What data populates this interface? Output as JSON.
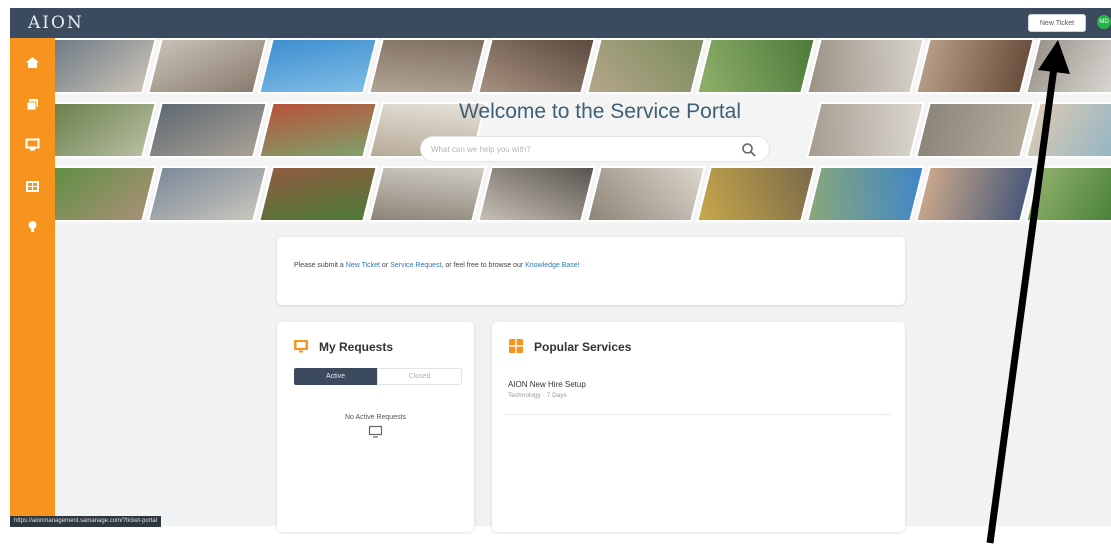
{
  "header": {
    "logo_text": "AION",
    "new_ticket_label": "New Ticket",
    "avatar_initials": "MD"
  },
  "sidebar": {
    "items": [
      {
        "icon": "home-icon"
      },
      {
        "icon": "copy-icon"
      },
      {
        "icon": "tv-icon"
      },
      {
        "icon": "catalog-icon"
      },
      {
        "icon": "lightbulb-icon"
      }
    ]
  },
  "banner": {
    "title": "Welcome to the Service Portal",
    "search_placeholder": "What can we help you with?"
  },
  "info": {
    "text_1": "Please submit a ",
    "link_new_ticket": "New Ticket",
    "text_2": " or ",
    "link_service_request": "Service Request",
    "text_3": ", or feel free to browse our ",
    "link_knowledge_base": "Knowledge Base!"
  },
  "my_requests": {
    "title": "My Requests",
    "tab_active": "Active",
    "tab_closed": "Closed",
    "empty_text": "No Active Requests"
  },
  "popular_services": {
    "title": "Popular Services",
    "items": [
      {
        "name": "AION New Hire Setup",
        "meta": "Technology · 7 Days"
      }
    ]
  },
  "status_bar": {
    "url": "https://aionmanagement.samanage.com/?ticket-portal"
  },
  "colors": {
    "topbar": "#3b4a5c",
    "sidebar": "#f7941d",
    "link": "#2b7bb9",
    "avatar": "#26b34a"
  }
}
